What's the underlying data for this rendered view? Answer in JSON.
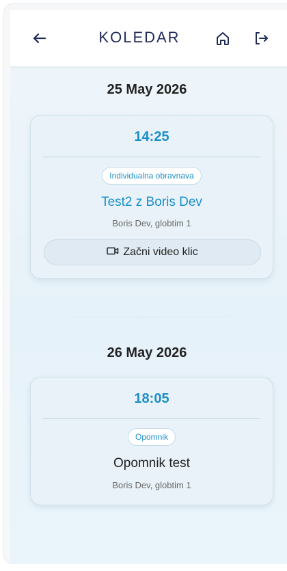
{
  "header": {
    "title": "KOLEDAR",
    "icons": {
      "back": "arrow-left-icon",
      "home": "home-icon",
      "logout": "logout-icon"
    }
  },
  "days": [
    {
      "date": "25 May 2026",
      "events": [
        {
          "time": "14:25",
          "type": "Individualna obravnava",
          "title": "Test2 z Boris Dev",
          "subtitle": "Boris Dev, globtim 1",
          "action_label": "Začni video klic",
          "action_icon": "video-camera-icon"
        }
      ]
    },
    {
      "date": "26 May 2026",
      "events": [
        {
          "time": "18:05",
          "type": "Opomnik",
          "title": "Opomnik test",
          "subtitle": "Boris Dev, globtim 1"
        }
      ]
    }
  ],
  "colors": {
    "accent": "#1a8fc7",
    "title": "#1f2a5a",
    "card_bg": "#e9f2f8"
  }
}
